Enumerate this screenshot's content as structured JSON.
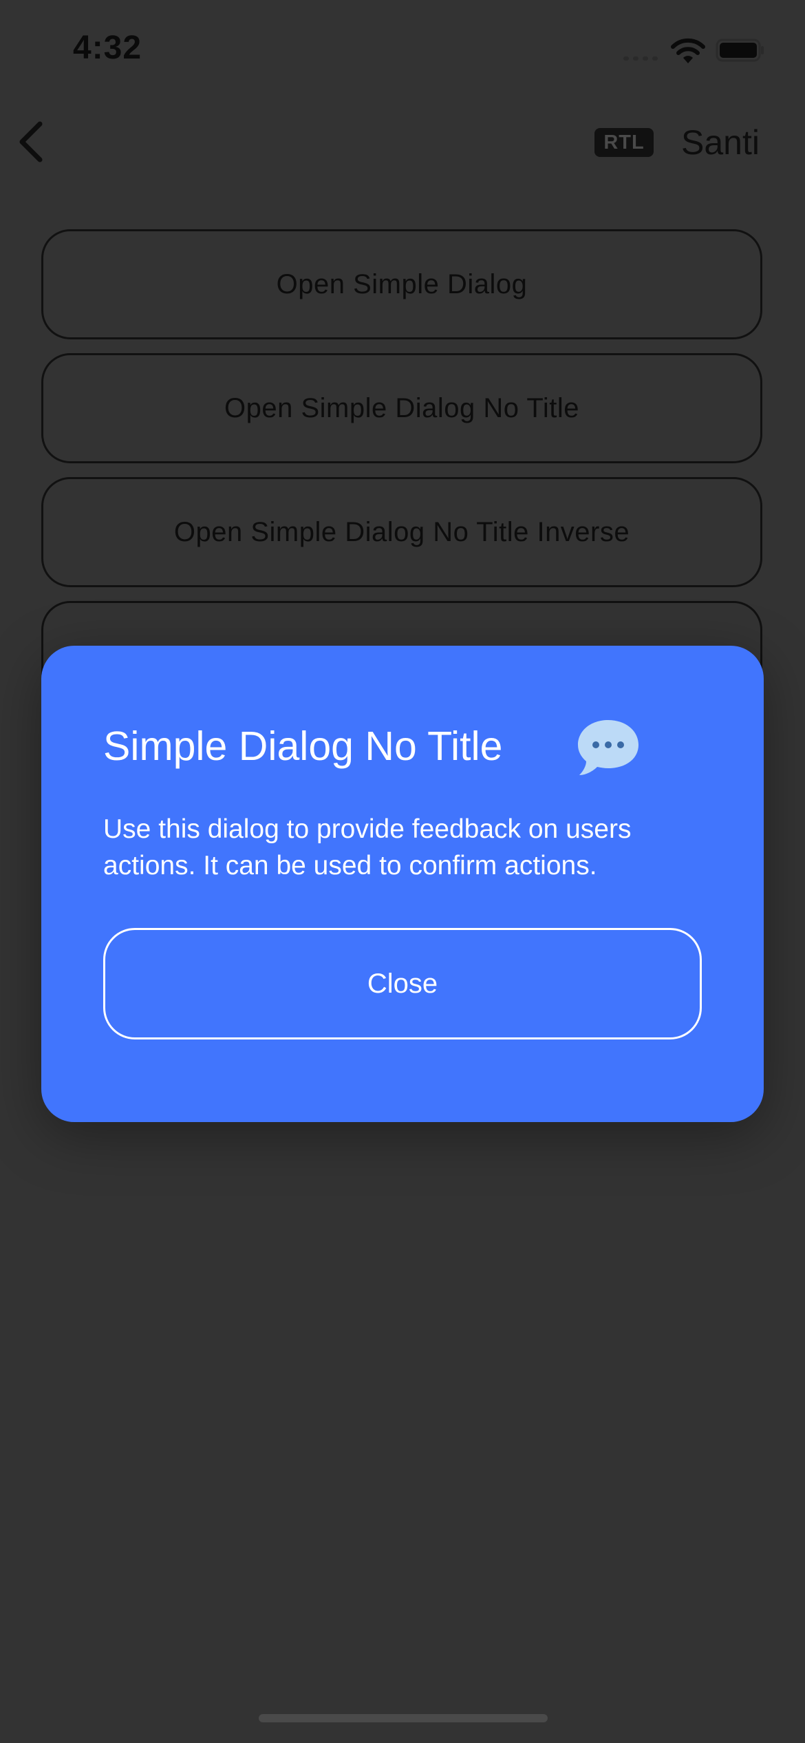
{
  "status_bar": {
    "time": "4:32"
  },
  "nav": {
    "back_icon": "chevron-left-icon",
    "rtl_badge": "RTL",
    "title": "Santi"
  },
  "buttons": [
    {
      "label": "Open Simple Dialog"
    },
    {
      "label": "Open Simple Dialog No Title"
    },
    {
      "label": "Open Simple Dialog No Title Inverse"
    },
    {
      "label": ""
    }
  ],
  "dialog": {
    "title": "Simple Dialog No Title",
    "icon": "speech-bubble-icon",
    "body": "Use this dialog to provide feedback on users actions. It can be used to confirm actions.",
    "close_label": "Close",
    "background": "#4175fd"
  },
  "colors": {
    "overlay_background": "#333333",
    "dialog_background": "#4175fd",
    "dialog_text": "#ffffff"
  }
}
